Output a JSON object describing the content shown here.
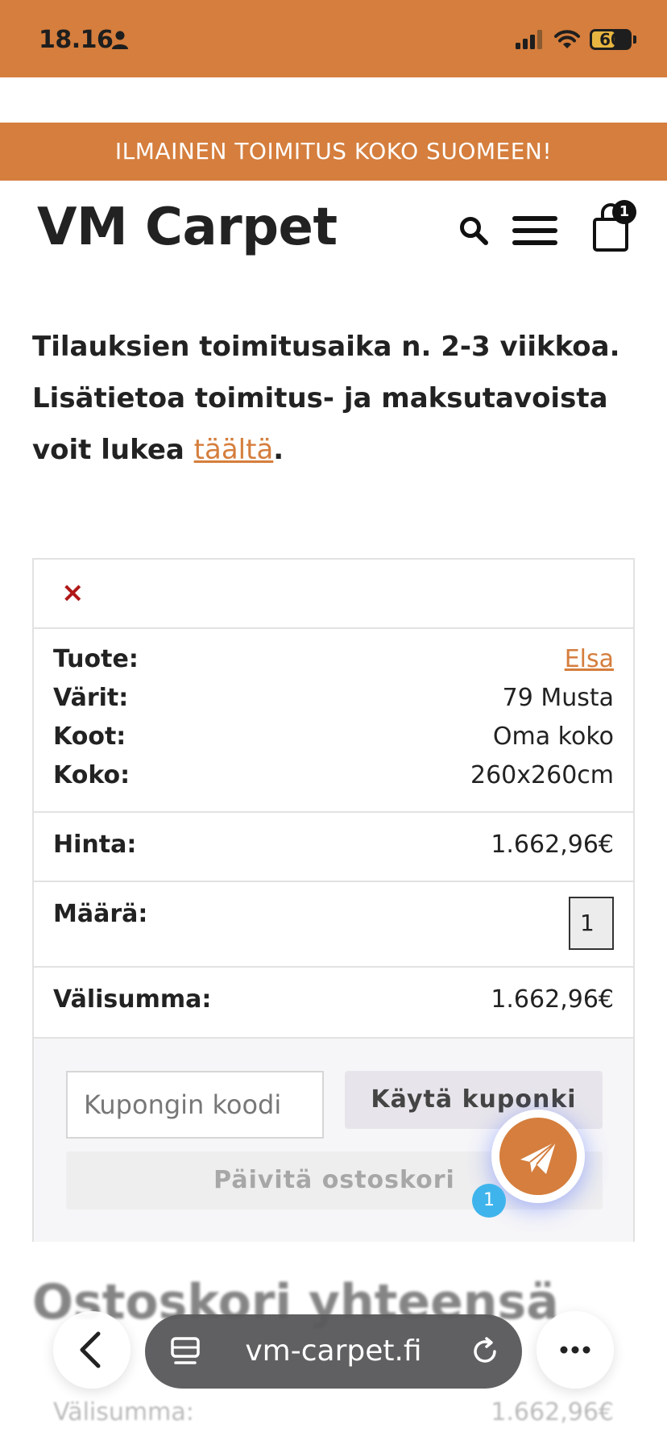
{
  "status_bar": {
    "time": "18.16",
    "battery": "60",
    "battery_level": 0.6
  },
  "announcement": "ILMAINEN TOIMITUS KOKO SUOMEEN!",
  "header": {
    "brand": "VM Carpet",
    "cart_count": "1",
    "icons": [
      "search-icon",
      "menu-icon",
      "shopping-bag-icon"
    ]
  },
  "notice": {
    "line1": "Tilauksien toimitusaika n. 2-3 viikkoa.",
    "line2_pre": "Lisätietoa toimitus- ja maksutavoista voit lukea ",
    "link": "täältä",
    "line2_post": "."
  },
  "cart": {
    "remove_symbol": "×",
    "product_label": "Tuote:",
    "product_value": "Elsa",
    "colors_label": "Värit:",
    "colors_value": "79 Musta",
    "sizes_label": "Koot:",
    "sizes_value": "Oma koko",
    "size_label": "Koko:",
    "size_value": "260x260cm",
    "price_label": "Hinta:",
    "price_value": "1.662,96€",
    "qty_label": "Määrä:",
    "qty_value": "1",
    "subtotal_label": "Välisumma:",
    "subtotal_value": "1.662,96€",
    "coupon_placeholder": "Kupongin koodi",
    "coupon_button": "Käytä kuponki",
    "update_button": "Päivitä ostoskori"
  },
  "chat": {
    "badge": "1"
  },
  "totals": {
    "title": "Ostoskori yhteensä",
    "subtotal_label": "Välisumma:",
    "subtotal_value": "1.662,96€"
  },
  "browser": {
    "url": "vm-carpet.fi"
  },
  "colors": {
    "brand_orange": "#d57e3d",
    "remove_red": "#b01818",
    "chat_badge_blue": "#3fb4ec"
  }
}
